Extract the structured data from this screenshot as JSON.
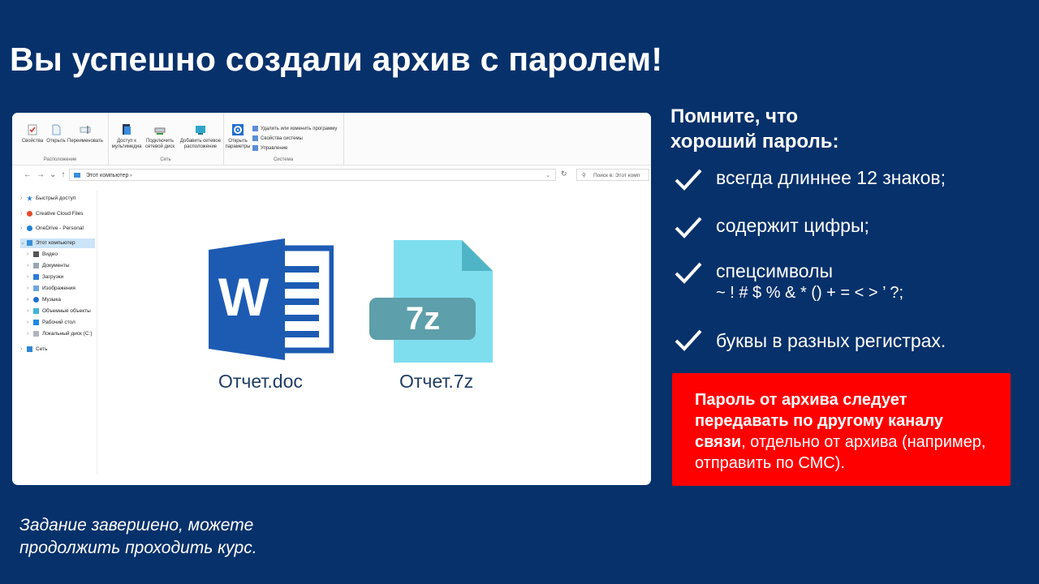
{
  "slide": {
    "title": "Вы успешно создали архив с паролем!",
    "footer_line1": "Задание завершено, можете",
    "footer_line2": "продолжить проходить курс.",
    "background_color": "#07316b"
  },
  "explorer": {
    "ribbon": {
      "group_location": {
        "label": "Расположение",
        "buttons": [
          "Свойства",
          "Открыть",
          "Переименовать"
        ]
      },
      "group_network": {
        "label": "Сеть",
        "buttons": [
          {
            "line1": "Доступ к",
            "line2": "мультимедиа"
          },
          {
            "line1": "Подключить",
            "line2": "сетевой диск"
          },
          {
            "line1": "Добавить сетевое",
            "line2": "расположение"
          }
        ]
      },
      "group_system": {
        "label": "Система",
        "big_button": {
          "line1": "Открыть",
          "line2": "параметры"
        },
        "small_items": [
          "Удалить или изменить программу",
          "Свойства системы",
          "Управление"
        ]
      }
    },
    "address_path": "Этот компьютер",
    "search_placeholder": "Поиск в: Этот комп",
    "tree": [
      {
        "label": "Быстрый доступ",
        "icon": "star-icon"
      },
      {
        "label": "Creative Cloud Files",
        "icon": "creative-cloud-icon"
      },
      {
        "label": "OneDrive - Personal",
        "icon": "cloud-icon"
      },
      {
        "label": "Этот компьютер",
        "icon": "computer-icon",
        "selected": true
      },
      {
        "label": "Видео",
        "icon": "video-icon"
      },
      {
        "label": "Документы",
        "icon": "documents-icon"
      },
      {
        "label": "Загрузки",
        "icon": "download-icon"
      },
      {
        "label": "Изображения",
        "icon": "images-icon"
      },
      {
        "label": "Музыка",
        "icon": "music-icon"
      },
      {
        "label": "Объемные объекты",
        "icon": "3d-objects-icon"
      },
      {
        "label": "Рабочий стол",
        "icon": "desktop-icon"
      },
      {
        "label": "Локальный диск (C:)",
        "icon": "disk-icon"
      },
      {
        "label": "Сеть",
        "icon": "network-icon"
      }
    ],
    "files": [
      {
        "name": "Отчет.doc",
        "icon": "word-document-icon",
        "badge": "W"
      },
      {
        "name": "Отчет.7z",
        "icon": "7z-archive-icon",
        "badge": "7z"
      }
    ]
  },
  "tips": {
    "heading_line1": "Помните, что",
    "heading_line2": "хороший пароль:",
    "items": [
      "всегда длиннее 12 знаков;",
      "содержит цифры;",
      "спецсимволы",
      "буквы в разных регистрах."
    ],
    "special_chars": "~ ! # $ % & * () + = < > ’ ?;"
  },
  "warning": {
    "bold_part": "Пароль от архива следует передавать по другому каналу связи",
    "normal_part": ", отдельно от архива (например, отправить по СМС).",
    "background_color": "#ff0000"
  }
}
